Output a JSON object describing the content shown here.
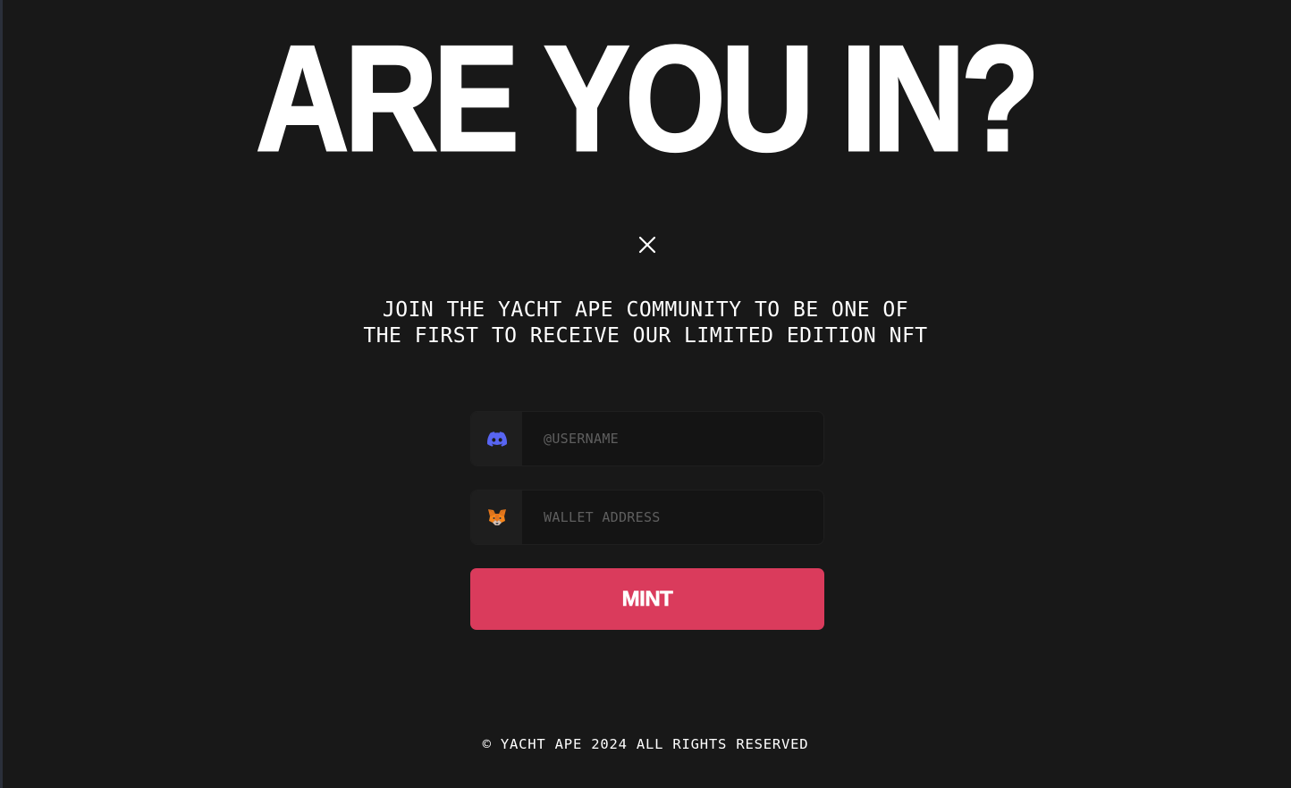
{
  "hero": {
    "headline": "ARE YOU IN?"
  },
  "modal": {
    "close_icon": "close-icon",
    "tagline": "JOIN THE YACHT APE COMMUNITY TO BE ONE OF THE FIRST TO RECEIVE OUR LIMITED EDITION NFT"
  },
  "form": {
    "discord": {
      "icon": "discord-icon",
      "placeholder": "@USERNAME",
      "value": ""
    },
    "wallet": {
      "icon": "metamask-fox-icon",
      "placeholder": "WALLET ADDRESS",
      "value": ""
    },
    "submit_label": "MINT"
  },
  "footer": {
    "copyright": "© YACHT APE 2024 ALL RIGHTS RESERVED"
  },
  "colors": {
    "background": "#181818",
    "accent": "#da3b5c",
    "discord": "#5865f2",
    "metamask": "#e2761b"
  }
}
